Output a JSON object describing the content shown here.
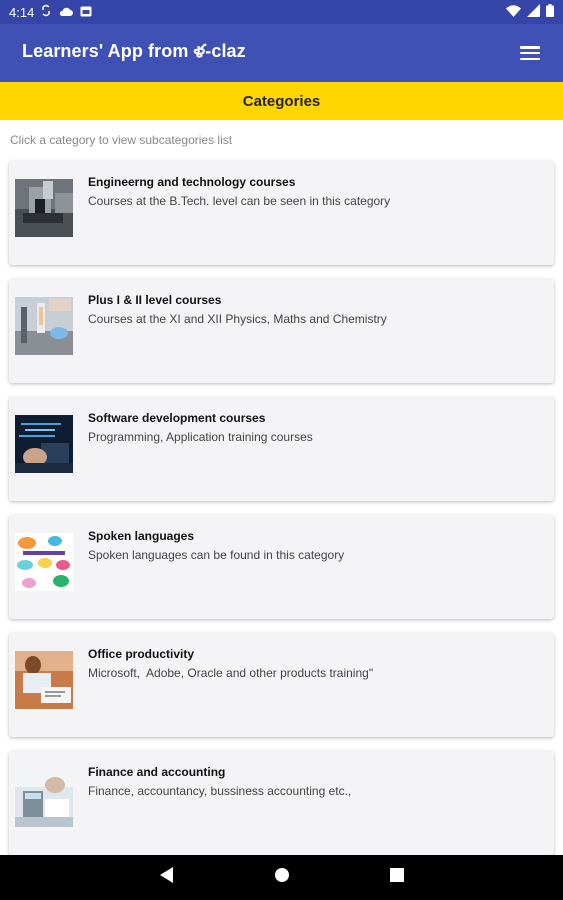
{
  "status_bar": {
    "time": "4:14"
  },
  "app_bar": {
    "title": "Learners' App from ళ-claz"
  },
  "banner": {
    "title": "Categories"
  },
  "hint": "Click a category to view subcategories list",
  "categories": [
    {
      "title": "Engineerng and technology courses",
      "subtitle": "Courses at the B.Tech. level can be seen in this category",
      "image": "machinery-image"
    },
    {
      "title": "Plus I & II level courses",
      "subtitle": "Courses at the XI and XII Physics, Maths and Chemistry",
      "image": "lab-image"
    },
    {
      "title": "Software development courses",
      "subtitle": "Programming, Application training courses",
      "image": "coding-image"
    },
    {
      "title": "Spoken languages",
      "subtitle": "Spoken languages can be found in this category",
      "image": "languages-image"
    },
    {
      "title": "Office productivity",
      "subtitle": "Microsoft,  Adobe, Oracle and other products training\"",
      "image": "office-image"
    },
    {
      "title": "Finance and accounting",
      "subtitle": "Finance, accountancy, bussiness accounting etc.,",
      "image": "finance-image"
    }
  ],
  "colors": {
    "primary": "#3f51b5",
    "status_bar": "#3546a8",
    "banner": "#ffd600",
    "card": "#f4f4f6"
  }
}
